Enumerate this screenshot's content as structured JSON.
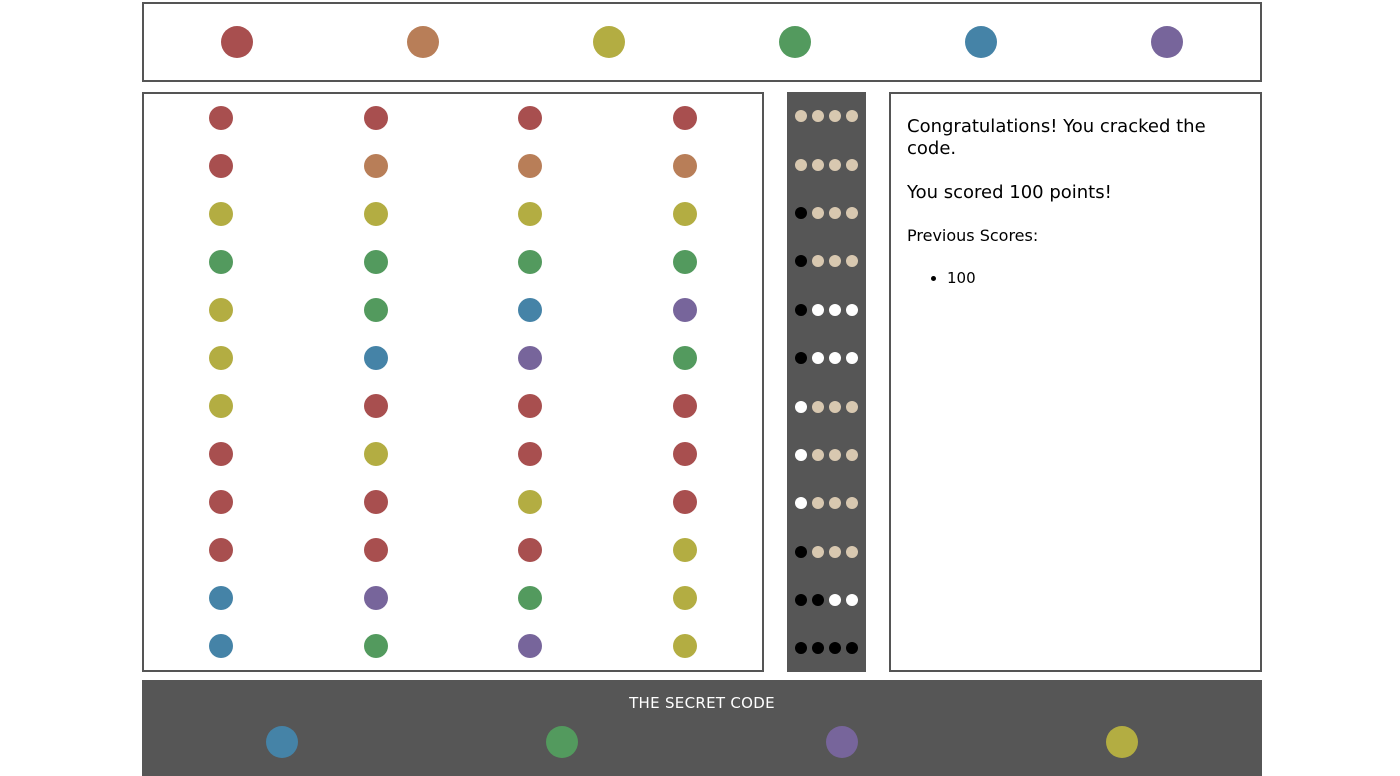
{
  "colors": {
    "red": "#a84f4f",
    "orange": "#b87e58",
    "yellow": "#b3ad42",
    "green": "#539a5e",
    "blue": "#4583a7",
    "purple": "#77659b"
  },
  "peg_colors": {
    "black": "#000000",
    "white": "#ffffff",
    "empty": "#d8c8b0"
  },
  "palette": [
    "red",
    "orange",
    "yellow",
    "green",
    "blue",
    "purple"
  ],
  "board": {
    "rows": [
      [
        "red",
        "red",
        "red",
        "red"
      ],
      [
        "red",
        "orange",
        "orange",
        "orange"
      ],
      [
        "yellow",
        "yellow",
        "yellow",
        "yellow"
      ],
      [
        "green",
        "green",
        "green",
        "green"
      ],
      [
        "yellow",
        "green",
        "blue",
        "purple"
      ],
      [
        "yellow",
        "blue",
        "purple",
        "green"
      ],
      [
        "yellow",
        "red",
        "red",
        "red"
      ],
      [
        "red",
        "yellow",
        "red",
        "red"
      ],
      [
        "red",
        "red",
        "yellow",
        "red"
      ],
      [
        "red",
        "red",
        "red",
        "yellow"
      ],
      [
        "blue",
        "purple",
        "green",
        "yellow"
      ],
      [
        "blue",
        "green",
        "purple",
        "yellow"
      ]
    ]
  },
  "feedback": {
    "rows": [
      [
        "empty",
        "empty",
        "empty",
        "empty"
      ],
      [
        "empty",
        "empty",
        "empty",
        "empty"
      ],
      [
        "black",
        "empty",
        "empty",
        "empty"
      ],
      [
        "black",
        "empty",
        "empty",
        "empty"
      ],
      [
        "black",
        "white",
        "white",
        "white"
      ],
      [
        "black",
        "white",
        "white",
        "white"
      ],
      [
        "white",
        "empty",
        "empty",
        "empty"
      ],
      [
        "white",
        "empty",
        "empty",
        "empty"
      ],
      [
        "white",
        "empty",
        "empty",
        "empty"
      ],
      [
        "black",
        "empty",
        "empty",
        "empty"
      ],
      [
        "black",
        "black",
        "white",
        "white"
      ],
      [
        "black",
        "black",
        "black",
        "black"
      ]
    ]
  },
  "info": {
    "message": "Congratulations! You cracked the code.",
    "score_message": "You scored 100 points!",
    "previous_label": "Previous Scores:",
    "previous_scores": [
      "100"
    ]
  },
  "secret": {
    "title": "THE SECRET CODE",
    "code": [
      "blue",
      "green",
      "purple",
      "yellow"
    ]
  }
}
